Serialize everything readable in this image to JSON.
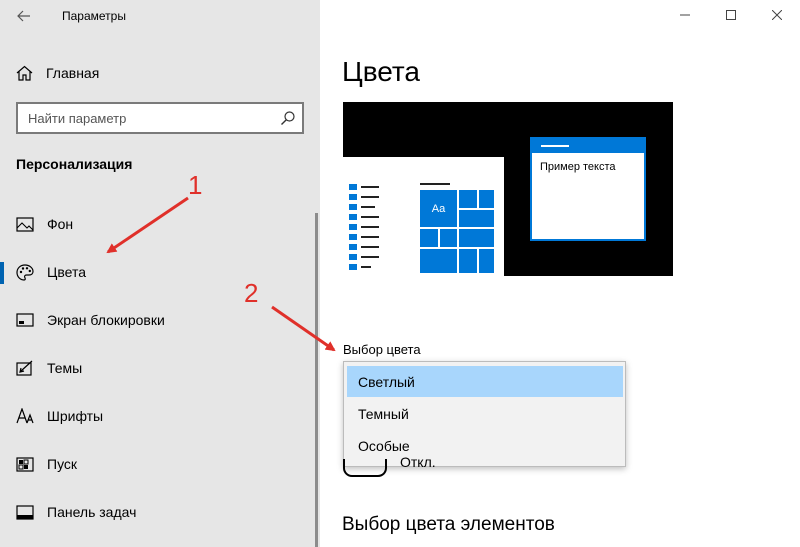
{
  "window": {
    "title": "Параметры",
    "controls": {
      "minimize_icon": "minimize-icon",
      "maximize_icon": "maximize-icon",
      "close_icon": "close-icon"
    }
  },
  "sidebar": {
    "home_label": "Главная",
    "search": {
      "placeholder": "Найти параметр",
      "value": ""
    },
    "section_title": "Персонализация",
    "items": [
      {
        "label": "Фон",
        "icon": "picture-icon",
        "active": false
      },
      {
        "label": "Цвета",
        "icon": "palette-icon",
        "active": true
      },
      {
        "label": "Экран блокировки",
        "icon": "lockscreen-icon",
        "active": false
      },
      {
        "label": "Темы",
        "icon": "themes-icon",
        "active": false
      },
      {
        "label": "Шрифты",
        "icon": "fonts-icon",
        "active": false
      },
      {
        "label": "Пуск",
        "icon": "start-icon",
        "active": false
      },
      {
        "label": "Панель задач",
        "icon": "taskbar-icon",
        "active": false
      }
    ]
  },
  "main": {
    "title": "Цвета",
    "preview": {
      "tile_label": "Aa",
      "window_text": "Пример текста"
    },
    "color_choice": {
      "label": "Выбор цвета",
      "options": [
        "Светлый",
        "Темный",
        "Особые"
      ],
      "selected": "Светлый"
    },
    "toggle_text": "Откл.",
    "section2_title": "Выбор цвета элементов"
  },
  "annotations": {
    "marker_1": "1",
    "marker_2": "2"
  },
  "colors": {
    "accent": "#0078d7",
    "selection": "#a8d6fc",
    "sidebar_bg": "#e6e6e6",
    "annotation": "#e0302a"
  }
}
